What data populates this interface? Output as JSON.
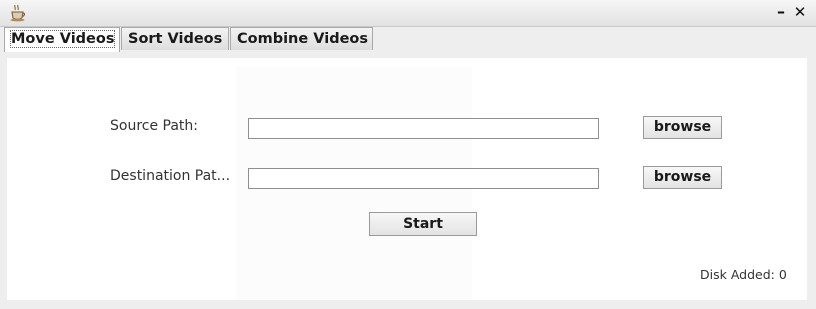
{
  "window": {
    "app_icon": "coffee-cup-icon",
    "minimize_glyph": "–",
    "close_glyph": "✕"
  },
  "tabs": [
    {
      "label": "Move Videos",
      "selected": true
    },
    {
      "label": "Sort Videos",
      "selected": false
    },
    {
      "label": "Combine Videos",
      "selected": false
    }
  ],
  "form": {
    "source_label": "Source Path:",
    "source_value": "",
    "destination_label": "Destination Pat...",
    "destination_value": "",
    "browse_label": "browse",
    "start_label": "Start"
  },
  "status": {
    "disk_added_label": "Disk Added:",
    "disk_added_value": "0"
  }
}
